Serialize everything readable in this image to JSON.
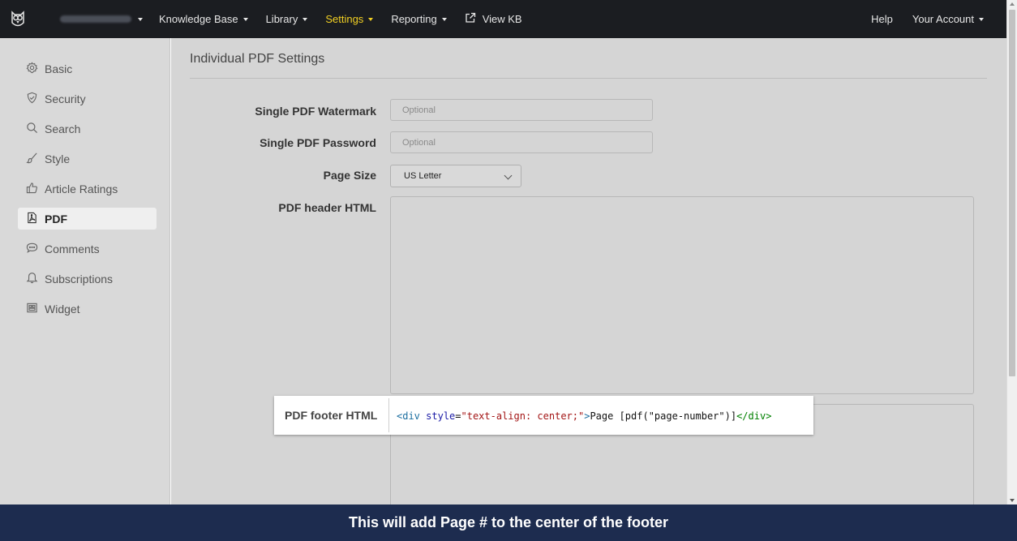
{
  "topbar": {
    "nav": [
      {
        "label": "Knowledge Base",
        "has_caret": true
      },
      {
        "label": "Library",
        "has_caret": true
      },
      {
        "label": "Settings",
        "has_caret": true
      },
      {
        "label": "Reporting",
        "has_caret": true
      },
      {
        "label": "View KB",
        "icon": "external-link-icon"
      }
    ],
    "help_label": "Help",
    "account_label": "Your Account",
    "active_color": "#f2d023",
    "background": "#1b1d21"
  },
  "sidebar": {
    "items": [
      {
        "label": "Basic",
        "icon": "gear-icon"
      },
      {
        "label": "Security",
        "icon": "shield-icon"
      },
      {
        "label": "Search",
        "icon": "search-icon"
      },
      {
        "label": "Style",
        "icon": "paint-brush-icon"
      },
      {
        "label": "Article Ratings",
        "icon": "thumbs-up-icon"
      },
      {
        "label": "PDF",
        "icon": "pdf-file-icon",
        "active": true
      },
      {
        "label": "Comments",
        "icon": "comment-icon"
      },
      {
        "label": "Subscriptions",
        "icon": "bell-icon"
      },
      {
        "label": "Widget",
        "icon": "widget-icon"
      }
    ]
  },
  "main": {
    "title": "Individual PDF Settings",
    "fields": {
      "watermark": {
        "label": "Single PDF Watermark",
        "placeholder": "Optional",
        "value": ""
      },
      "password": {
        "label": "Single PDF Password",
        "placeholder": "Optional",
        "value": ""
      },
      "page_size": {
        "label": "Page Size",
        "value": "US Letter"
      },
      "header_html": {
        "label": "PDF header HTML",
        "value": ""
      },
      "footer_html": {
        "label": "PDF footer HTML",
        "code": {
          "open_tag": "<div",
          "attr": "style",
          "eq": "=",
          "attr_value": "\"text-align: center;\"",
          "gt": ">",
          "text": "Page [pdf(\"page-number\")]",
          "close_tag": "</div>"
        }
      }
    }
  },
  "caption": "This will add Page # to the center of the footer"
}
